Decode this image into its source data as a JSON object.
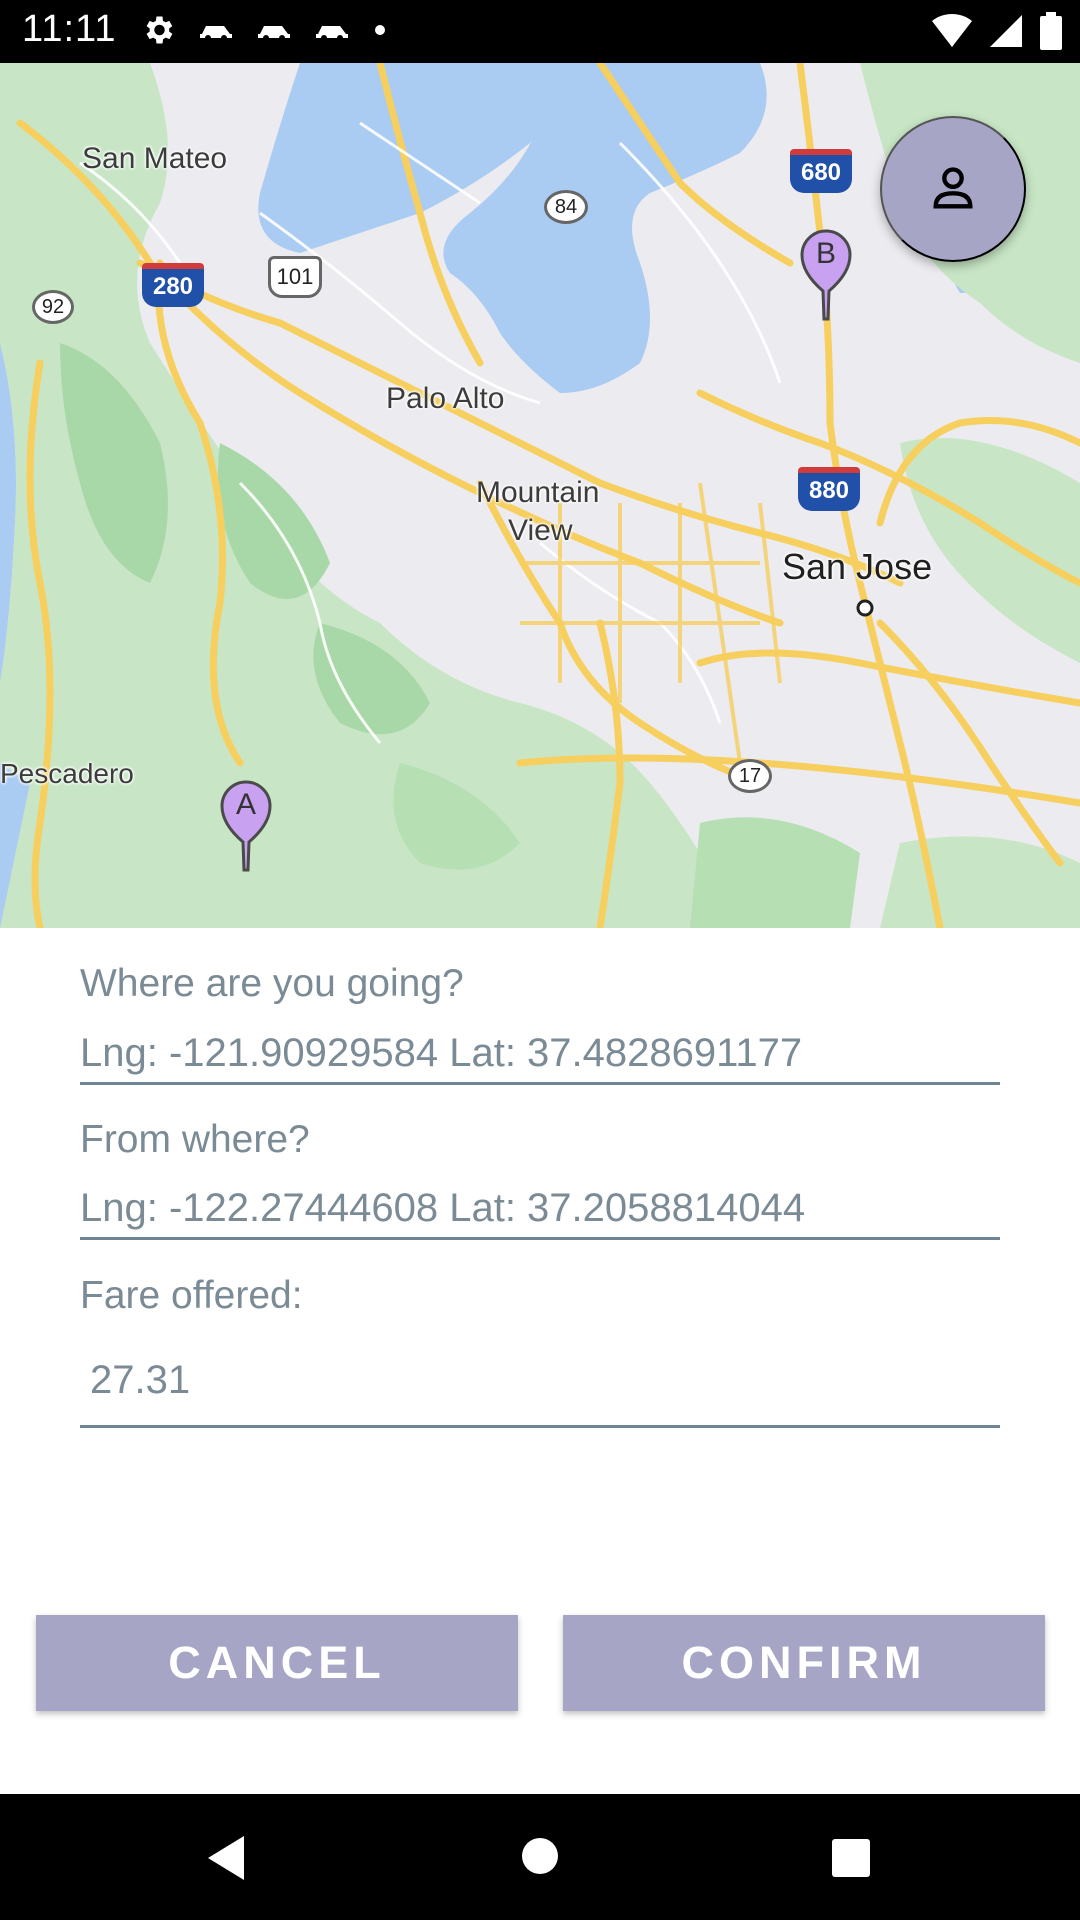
{
  "status_bar": {
    "time": "11:11",
    "icons_left": [
      "gear-icon",
      "car-icon",
      "car-icon",
      "car-icon",
      "dot-icon"
    ],
    "icons_right": [
      "wifi-icon",
      "signal-icon",
      "battery-icon"
    ]
  },
  "map": {
    "labels": {
      "san_mateo": "San Mateo",
      "palo_alto": "Palo Alto",
      "mountain_view_1": "Mountain",
      "mountain_view_2": "View",
      "san_jose": "San Jose",
      "pescadero": "Pescadero"
    },
    "shields": {
      "i280": "280",
      "us101": "101",
      "ca92": "92",
      "ca84": "84",
      "i680": "680",
      "i880": "880",
      "ca17": "17"
    },
    "markers": {
      "a": "A",
      "b": "B"
    },
    "colors": {
      "water": "#aacbf2",
      "park": "#c5e8c5",
      "road": "#fcd465",
      "marker": "#c8a2f0"
    }
  },
  "profile_button": {
    "icon": "person-icon"
  },
  "form": {
    "destination_label": "Where are you going?",
    "destination_value": "Lng: -121.90929584 Lat: 37.4828691177",
    "origin_label": "From where?",
    "origin_value": "Lng: -122.27444608 Lat: 37.2058814044",
    "fare_label": "Fare offered:",
    "fare_value": "27.31"
  },
  "buttons": {
    "cancel": "CANCEL",
    "confirm": "CONFIRM",
    "color": "#a7a5c6"
  },
  "nav_bar": {
    "back": "back-icon",
    "home": "home-icon",
    "recents": "recents-icon"
  }
}
